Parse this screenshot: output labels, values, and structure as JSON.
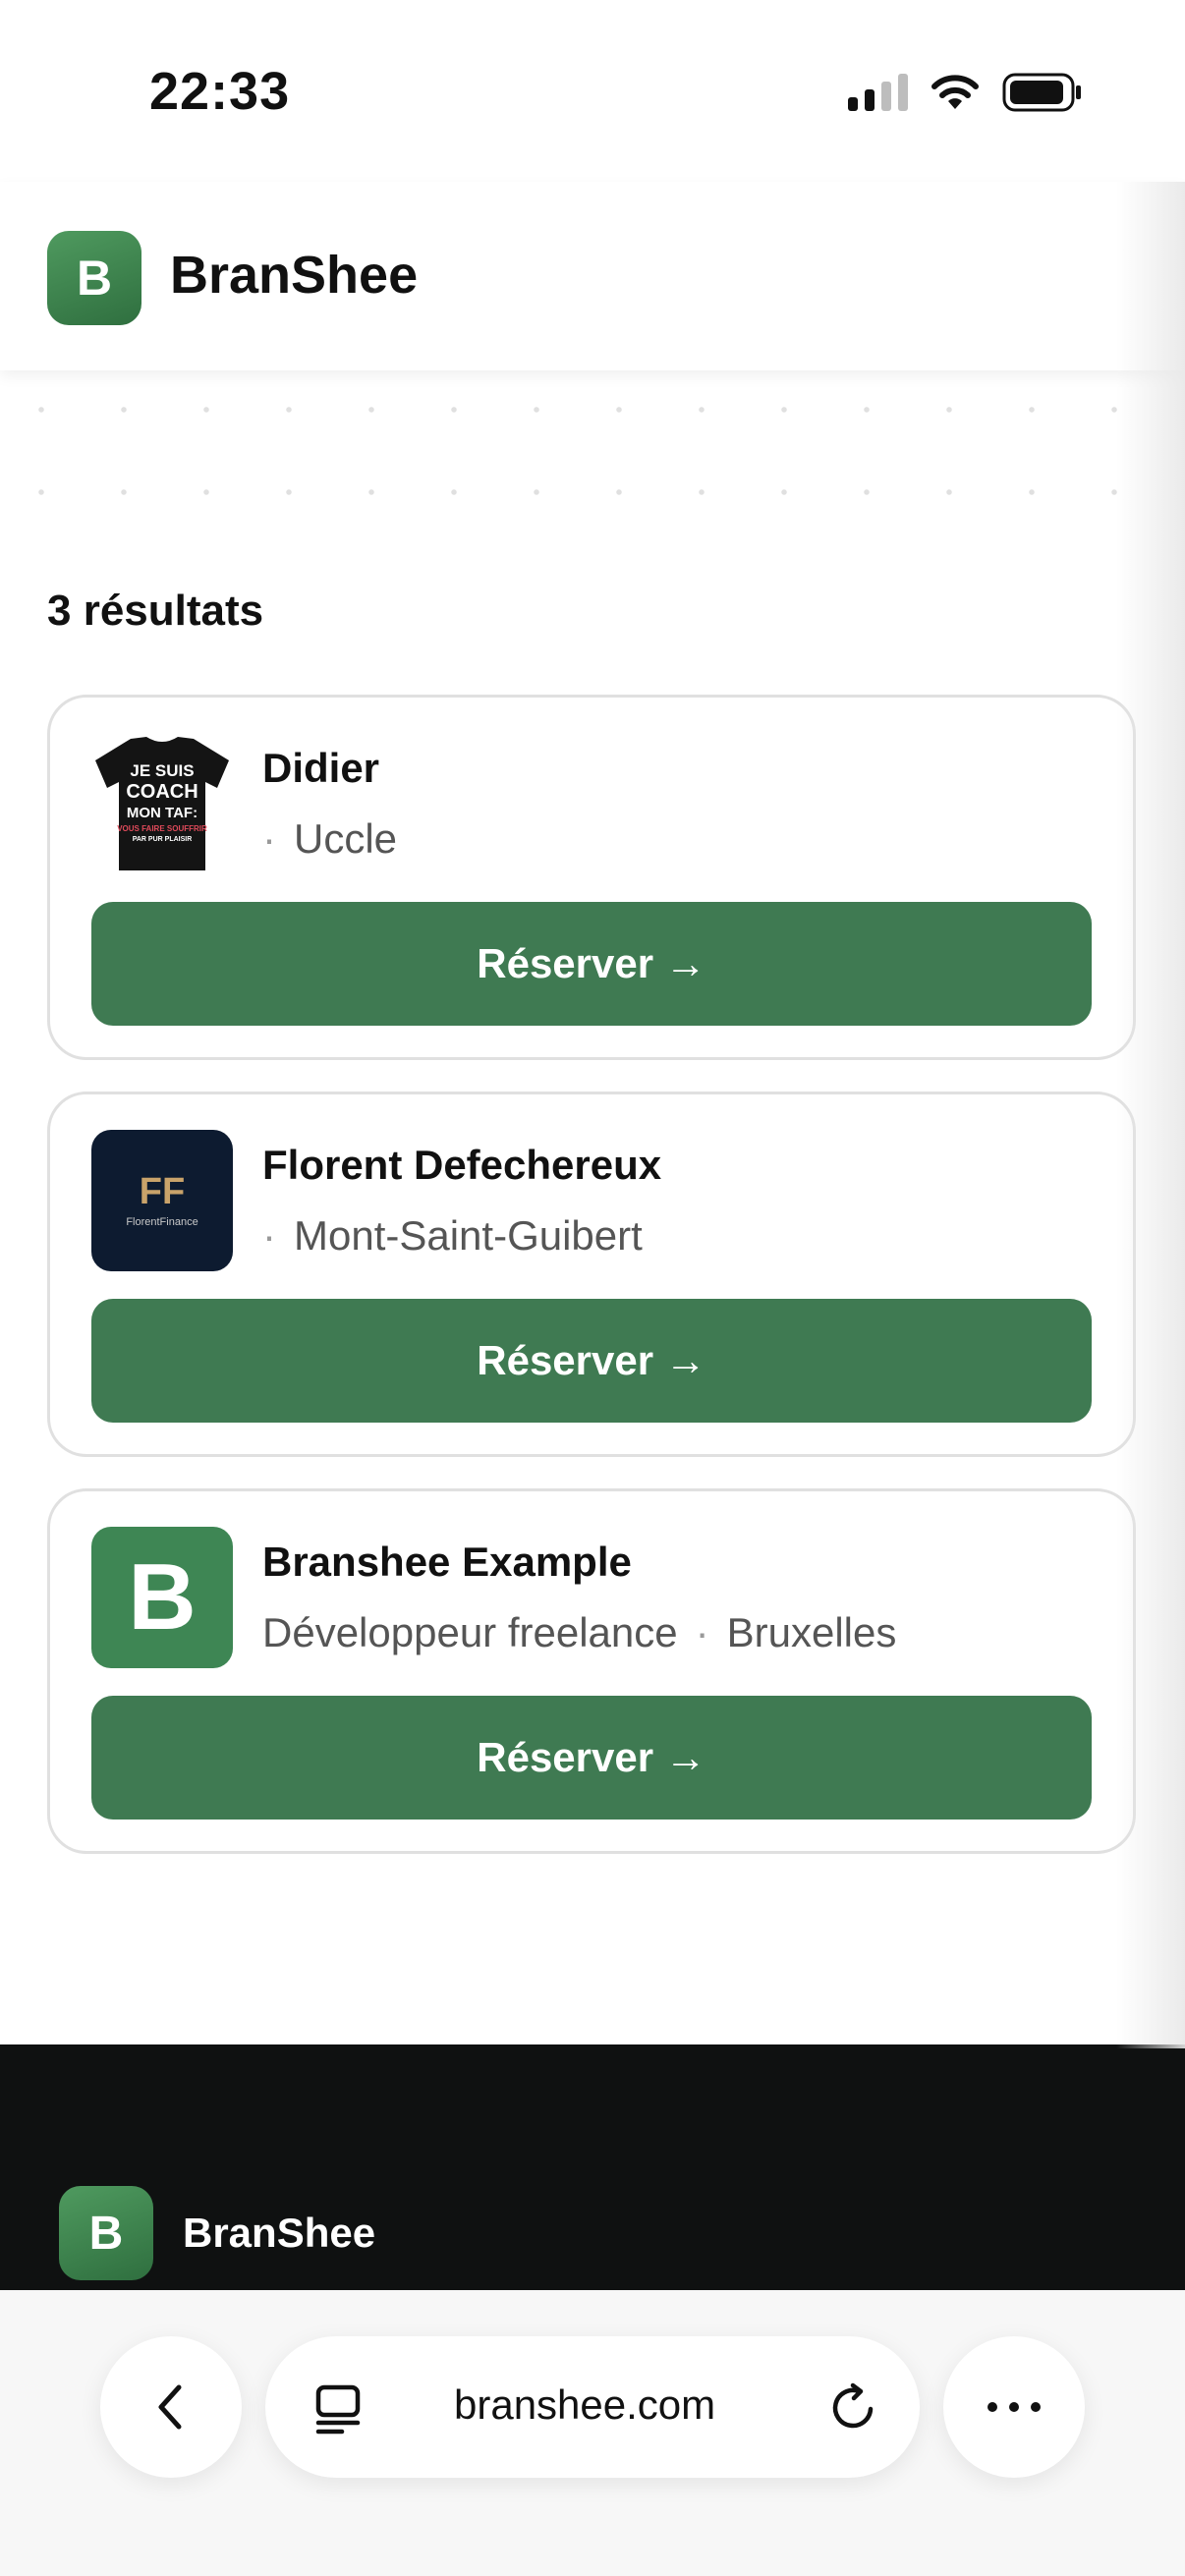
{
  "status_bar": {
    "time": "22:33"
  },
  "header": {
    "logo_letter": "B",
    "brand": "BranShee"
  },
  "results": {
    "count_label": "3 résultats",
    "items": [
      {
        "name": "Didier",
        "profession": "",
        "city": "Uccle",
        "separator": "·",
        "button": "Réserver →",
        "avatar": "tshirt-coach-image",
        "avatar_text": "JE SUIS COACH MON TAF: VOUS FAIRE SOUFFRIR PAR PUR PLAISIR"
      },
      {
        "name": "Florent Defechereux",
        "profession": "",
        "city": "Mont-Saint-Guibert",
        "separator": "·",
        "button": "Réserver →",
        "avatar": "florent-finance-logo",
        "avatar_mark": "FF",
        "avatar_caption": "FlorentFinance"
      },
      {
        "name": "Branshee Example",
        "profession": "Développeur freelance",
        "city": "Bruxelles",
        "separator": "·",
        "button": "Réserver →",
        "avatar": "branshee-b-logo",
        "avatar_letter": "B"
      }
    ]
  },
  "footer": {
    "logo_letter": "B",
    "brand": "BranShee"
  },
  "browser": {
    "url": "branshee.com",
    "icons": [
      "chevron-left-icon",
      "tabs-icon",
      "reload-icon",
      "more-icon"
    ]
  },
  "colors": {
    "brand_green": "#3f7a52",
    "footer_bg": "#0f1111"
  }
}
